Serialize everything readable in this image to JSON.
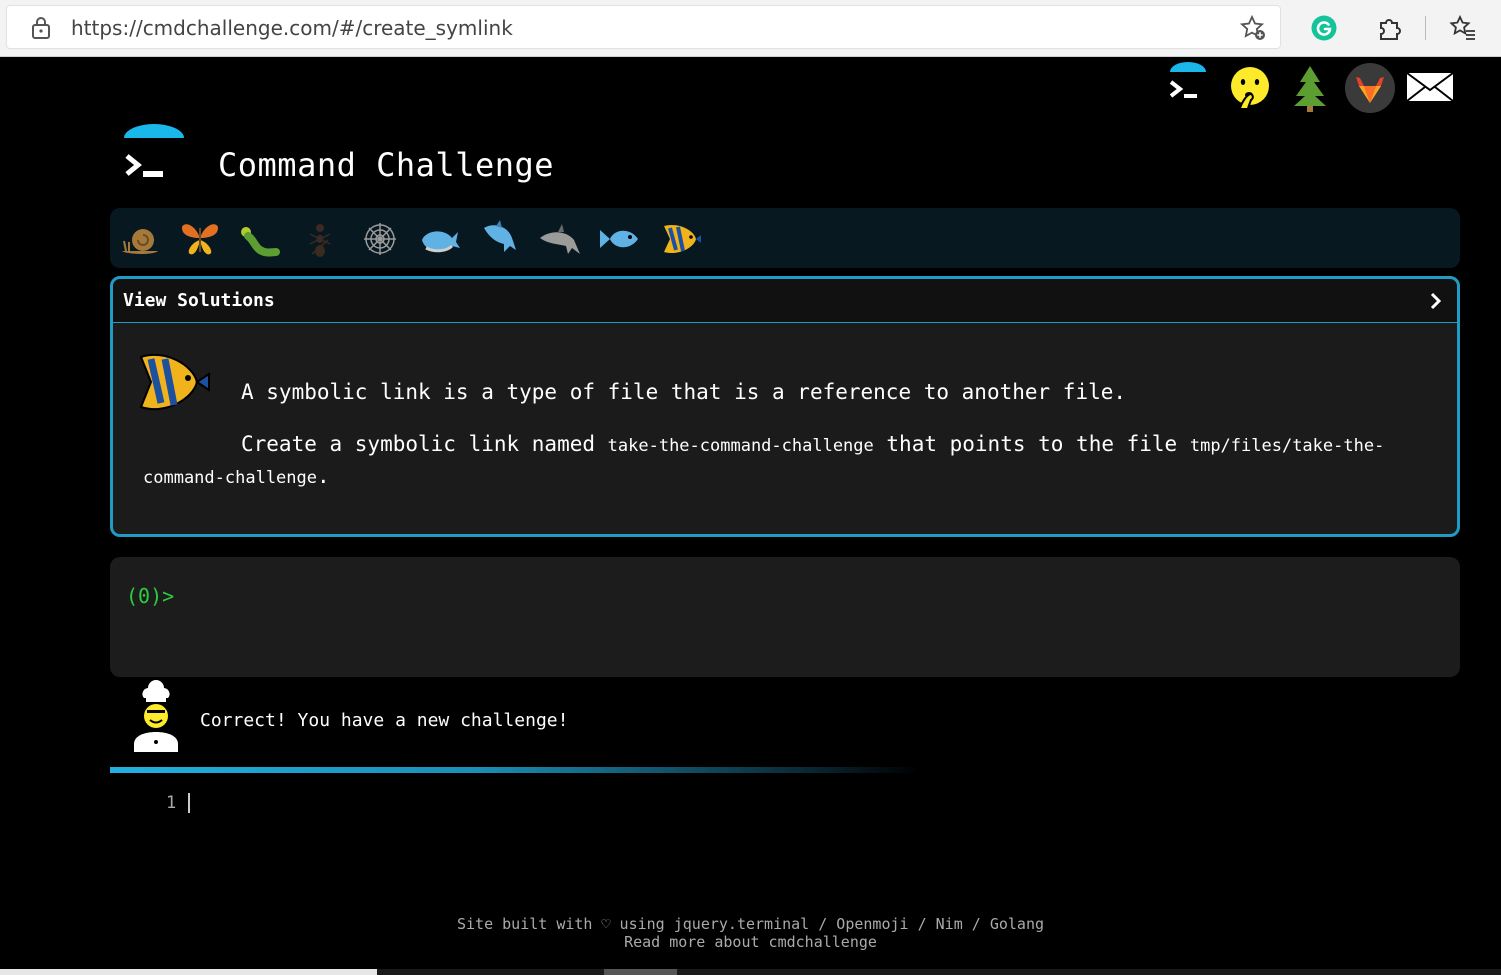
{
  "browser": {
    "url": "https://cmdchallenge.com/#/create_symlink"
  },
  "top_nav": {
    "icons": [
      "prompt-icon",
      "shushing-face-icon",
      "tree-icon",
      "gitlab-icon",
      "envelope-icon"
    ]
  },
  "header": {
    "title": "Command Challenge"
  },
  "levels": {
    "icons": [
      "snail-icon",
      "butterfly-icon",
      "caterpillar-icon",
      "ant-icon",
      "spider-web-icon",
      "whale-icon",
      "dolphin-icon",
      "dolphin-icon",
      "fish-icon",
      "tropical-fish-icon"
    ]
  },
  "challenge": {
    "view_solutions_label": "View Solutions",
    "description_line1": "A symbolic link is a type of file that is a reference to another file.",
    "description_part1": "Create a symbolic link named ",
    "link_name": "take-the-command-challenge",
    "description_part2": " that points to the file ",
    "target_path": "tmp/files/take-the-command-challenge",
    "description_end": "."
  },
  "terminal": {
    "prompt": "(0)>"
  },
  "feedback": {
    "message": "Correct! You have a new challenge!"
  },
  "progress": {
    "fraction": 1.0
  },
  "editor": {
    "line_number": "1"
  },
  "footer": {
    "line1_prefix": "Site built with ♡ using ",
    "link_jquery_terminal": "jquery.terminal",
    "sep": " / ",
    "link_openmoji": "Openmoji",
    "link_nim": "Nim",
    "link_golang": "Golang",
    "line2": "Read more about cmdchallenge"
  },
  "colors": {
    "accent": "#1f9bc6",
    "prompt_green": "#2ecc40"
  }
}
